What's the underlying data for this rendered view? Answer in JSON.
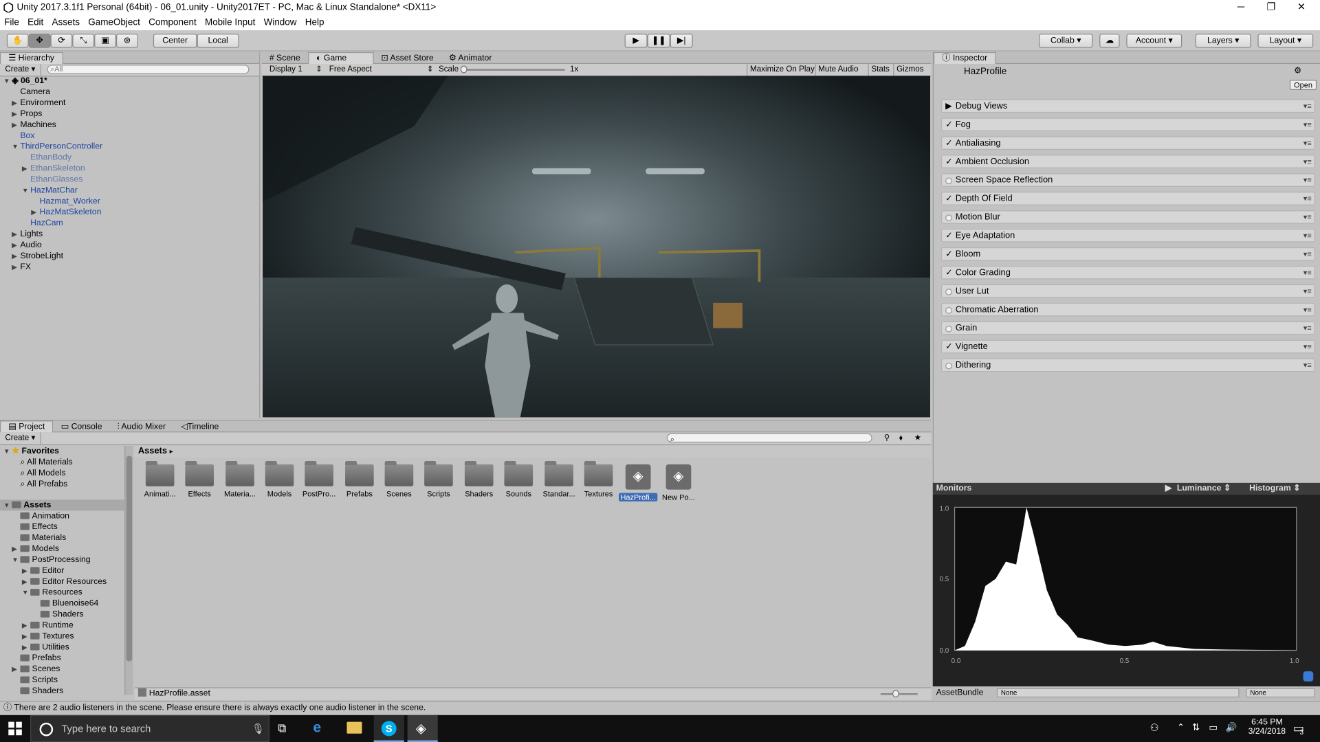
{
  "window": {
    "title": "Unity 2017.3.1f1 Personal (64bit) - 06_01.unity - Unity2017ET - PC, Mac & Linux Standalone* <DX11>"
  },
  "menu": [
    "File",
    "Edit",
    "Assets",
    "GameObject",
    "Component",
    "Mobile Input",
    "Window",
    "Help"
  ],
  "toolbar": {
    "center": "Center",
    "local": "Local",
    "collab": "Collab",
    "account": "Account",
    "layers": "Layers",
    "layout": "Layout"
  },
  "hierarchy": {
    "tab": "Hierarchy",
    "create": "Create",
    "search_placeholder": "All",
    "scene": "06_01*",
    "items": [
      "Camera",
      "Envirorment",
      "Props",
      "Machines",
      "Box",
      "ThirdPersonController",
      "EthanBody",
      "EthanSkeleton",
      "EthanGlasses",
      "HazMatChar",
      "Hazmat_Worker",
      "HazMatSkeleton",
      "HazCam",
      "Lights",
      "Audio",
      "StrobeLight",
      "FX"
    ]
  },
  "game": {
    "tabs": [
      "Scene",
      "Game",
      "Asset Store",
      "Animator"
    ],
    "display": "Display 1",
    "aspect": "Free Aspect",
    "scale_label": "Scale",
    "scale_value": "1x",
    "maximize": "Maximize On Play",
    "mute": "Mute Audio",
    "stats": "Stats",
    "gizmos": "Gizmos"
  },
  "inspector": {
    "tab": "Inspector",
    "name": "HazProfile",
    "open": "Open",
    "effects": [
      {
        "label": "Debug Views",
        "state": "collapsed"
      },
      {
        "label": "Fog",
        "state": "checked"
      },
      {
        "label": "Antialiasing",
        "state": "checked"
      },
      {
        "label": "Ambient Occlusion",
        "state": "checked"
      },
      {
        "label": "Screen Space Reflection",
        "state": "off"
      },
      {
        "label": "Depth Of Field",
        "state": "checked"
      },
      {
        "label": "Motion Blur",
        "state": "off"
      },
      {
        "label": "Eye Adaptation",
        "state": "checked"
      },
      {
        "label": "Bloom",
        "state": "checked"
      },
      {
        "label": "Color Grading",
        "state": "checked"
      },
      {
        "label": "User Lut",
        "state": "off"
      },
      {
        "label": "Chromatic Aberration",
        "state": "off"
      },
      {
        "label": "Grain",
        "state": "off"
      },
      {
        "label": "Vignette",
        "state": "checked"
      },
      {
        "label": "Dithering",
        "state": "off"
      }
    ]
  },
  "monitors": {
    "label": "Monitors",
    "luminance": "Luminance",
    "histogram": "Histogram",
    "y_ticks": [
      "1.0",
      "0.5",
      "0.0"
    ],
    "x_ticks": [
      "0.0",
      "0.5",
      "1.0"
    ]
  },
  "assetbundle": {
    "label": "AssetBundle",
    "value1": "None",
    "value2": "None"
  },
  "project": {
    "tabs": [
      "Project",
      "Console",
      "Audio Mixer",
      "Timeline"
    ],
    "create": "Create",
    "favorites": "Favorites",
    "fav_items": [
      "All Materials",
      "All Models",
      "All Prefabs"
    ],
    "assets_root": "Assets",
    "tree": [
      "Animation",
      "Effects",
      "Materials",
      "Models",
      "PostProcessing",
      "Editor",
      "Editor Resources",
      "Resources",
      "Bluenoise64",
      "Shaders",
      "Runtime",
      "Textures",
      "Utilities",
      "Prefabs",
      "Scenes",
      "Scripts",
      "Shaders"
    ],
    "breadcrumb": "Assets",
    "grid": [
      "Animati...",
      "Effects",
      "Materia...",
      "Models",
      "PostPro...",
      "Prefabs",
      "Scenes",
      "Scripts",
      "Shaders",
      "Sounds",
      "Standar...",
      "Textures",
      "HazProfi...",
      "New Po..."
    ],
    "selected_file": "HazProfile.asset"
  },
  "status": "There are 2 audio listeners in the scene. Please ensure there is always exactly one audio listener in the scene.",
  "taskbar": {
    "search": "Type here to search",
    "time": "6:45 PM",
    "date": "3/24/2018",
    "notif": "3"
  }
}
